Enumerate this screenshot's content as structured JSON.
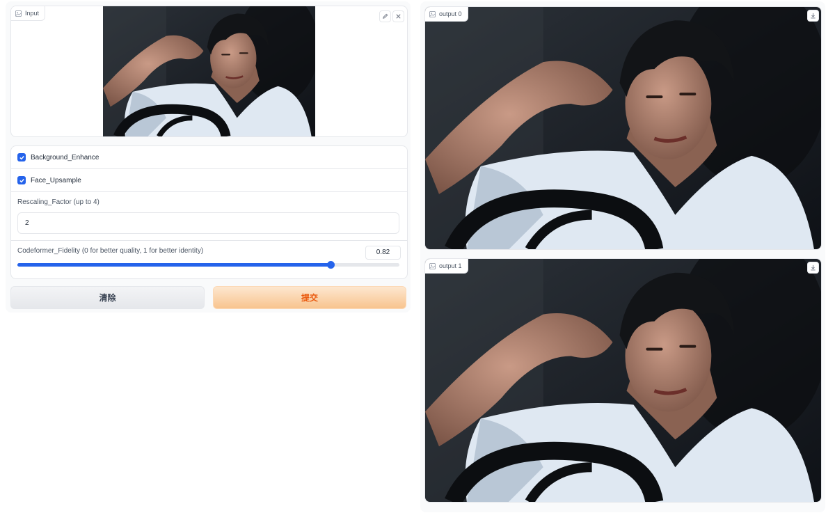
{
  "input_panel": {
    "label": "Input",
    "icons": {
      "label": "image-icon",
      "edit": "pencil-icon",
      "clear": "close-icon"
    }
  },
  "options": {
    "background_enhance": {
      "label": "Background_Enhance",
      "checked": true
    },
    "face_upsample": {
      "label": "Face_Upsample",
      "checked": true
    },
    "rescaling": {
      "label": "Rescaling_Factor (up to 4)",
      "value": "2"
    },
    "fidelity": {
      "label": "Codeformer_Fidelity (0 for better quality, 1 for better identity)",
      "value": "0.82",
      "fraction": 0.82
    }
  },
  "buttons": {
    "clear": "清除",
    "submit": "提交"
  },
  "outputs": [
    {
      "label": "output 0",
      "icon": "download-icon"
    },
    {
      "label": "output 1",
      "icon": "download-icon"
    }
  ],
  "colors": {
    "accent": "#2563eb",
    "submit_text": "#ea580c"
  }
}
